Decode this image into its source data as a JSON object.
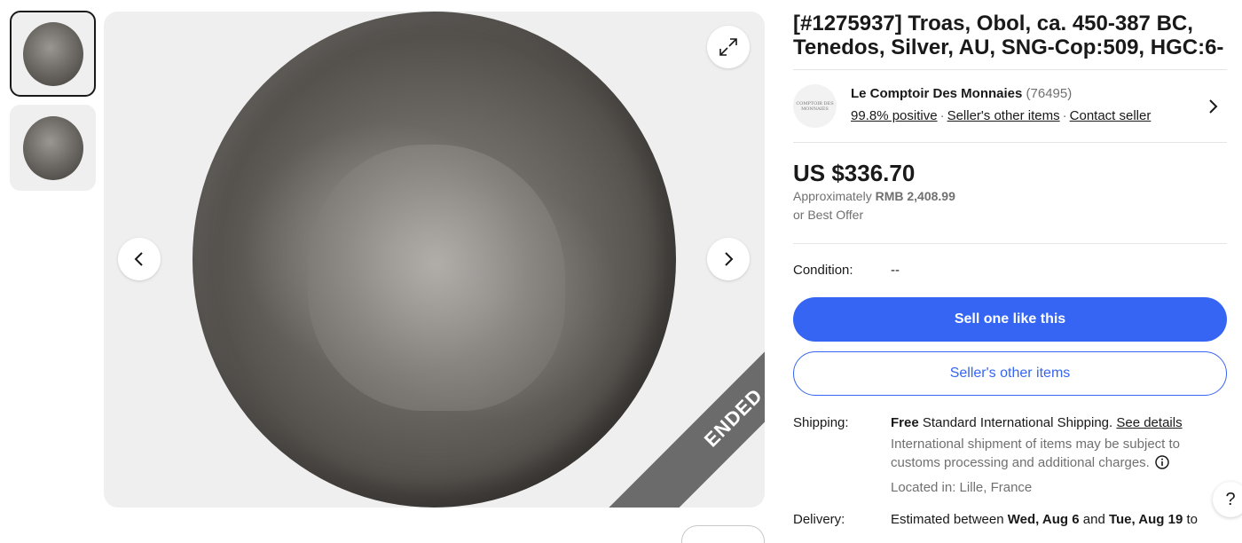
{
  "item": {
    "title": "[#1275937] Troas, Obol, ca. 450-387 BC, Tenedos, Silver, AU, SNG-Cop:509, HGC:6-",
    "status_ribbon": "ENDED"
  },
  "gallery": {
    "thumbnails": [
      "thumbnail-obverse",
      "thumbnail-reverse"
    ],
    "active_index": 0
  },
  "seller": {
    "name": "Le Comptoir Des Monnaies",
    "feedback_count": "(76495)",
    "positive": "99.8% positive",
    "other_items_link": "Seller's other items",
    "contact_link": "Contact seller",
    "logo_text": "COMPTOIR DES MONNAIES"
  },
  "price": {
    "amount": "US $336.70",
    "approx_prefix": "Approximately",
    "approx_value": "RMB 2,408.99",
    "best_offer": "or Best Offer"
  },
  "condition": {
    "label": "Condition:",
    "value": "--"
  },
  "actions": {
    "sell_one_like_this": "Sell one like this",
    "sellers_other_items": "Seller's other items"
  },
  "shipping": {
    "label": "Shipping:",
    "free": "Free",
    "service": "Standard International Shipping.",
    "see_details": "See details",
    "note": "International shipment of items may be subject to customs processing and additional charges.",
    "located": "Located in: Lille, France"
  },
  "delivery": {
    "label": "Delivery:",
    "prefix": "Estimated between",
    "start": "Wed, Aug 6",
    "and": "and",
    "end": "Tue, Aug 19",
    "suffix": "to"
  },
  "help": {
    "label": "?"
  },
  "colors": {
    "primary_blue": "#3665f3",
    "ended_ribbon": "#6b6b6b",
    "text": "#191919",
    "muted": "#707070"
  }
}
